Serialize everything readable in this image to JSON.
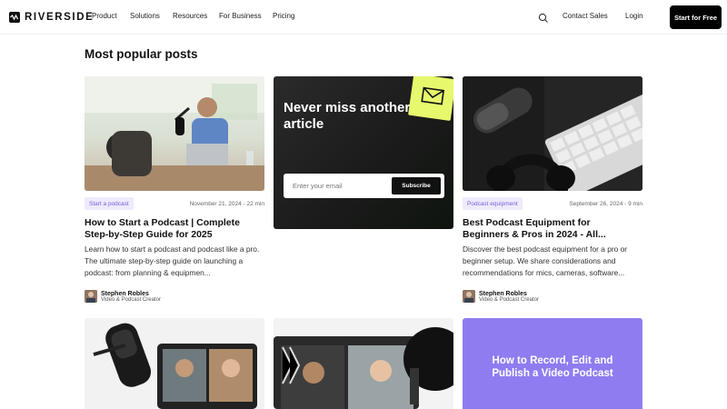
{
  "brand": {
    "name": "RIVERSIDE"
  },
  "nav": {
    "links": [
      "Product",
      "Solutions",
      "Resources",
      "For Business",
      "Pricing"
    ],
    "contact": "Contact Sales",
    "login": "Login",
    "cta": "Start for Free"
  },
  "section": {
    "heading": "Most popular posts"
  },
  "posts": [
    {
      "tag": "Start a podcast",
      "date": "November 21, 2024 - 22 min",
      "title": "How to Start a Podcast | Complete Step-by-Step Guide for 2025",
      "excerpt": "Learn how to start a podcast and podcast like a pro. The ultimate step-by-step guide on launching a podcast: from planning & equipmen...",
      "author": "Stephen Robles",
      "role": "Video & Podcast Creator"
    },
    {
      "tag": "Podcast equipment",
      "date": "September 26, 2024 - 9 min",
      "title": "Best Podcast Equipment for Beginners & Pros in 2024 - All...",
      "excerpt": "Discover the best podcast equipment for a pro or beginner setup. We share considerations and recommendations for mics, cameras, software...",
      "author": "Stephen Robles",
      "role": "Video & Podcast Creator"
    }
  ],
  "newsletter": {
    "title": "Never miss another article",
    "placeholder": "Enter your email",
    "button": "Subscribe"
  },
  "promo": {
    "text": "How to Record, Edit and Publish a Video Podcast"
  }
}
